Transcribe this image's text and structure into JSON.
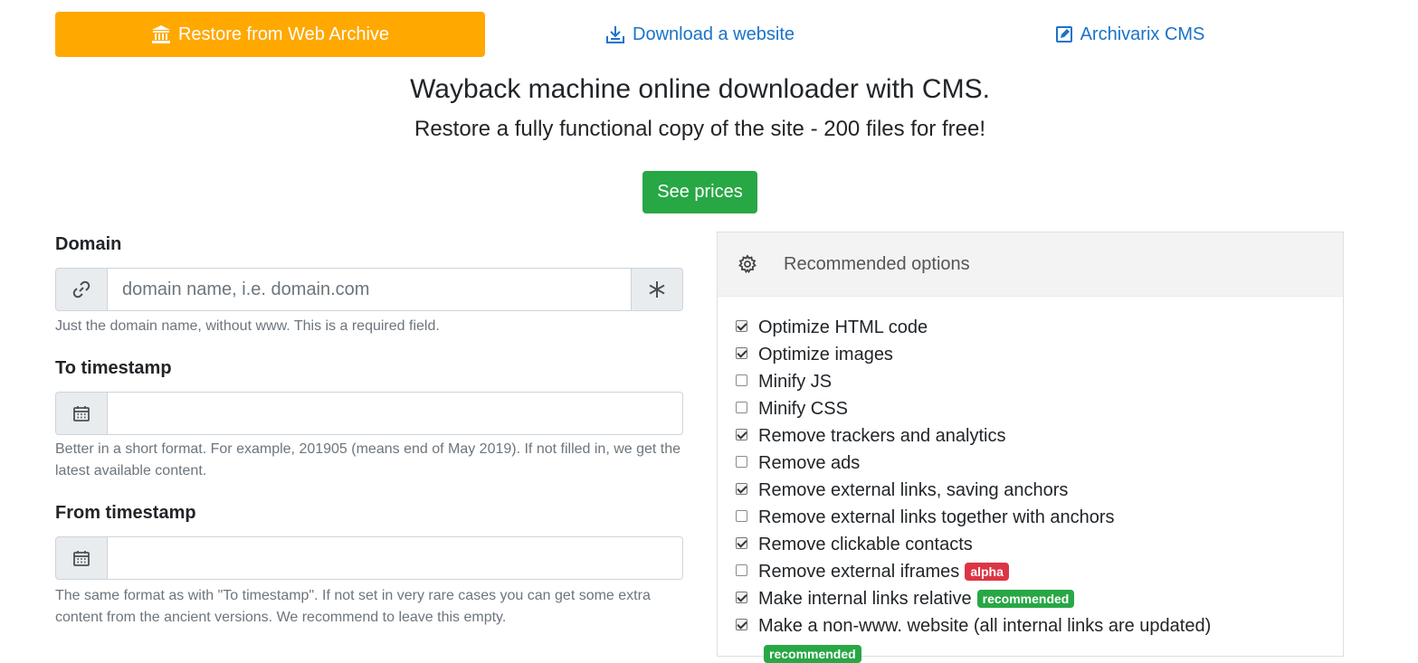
{
  "nav": {
    "restore_label": "Restore from Web Archive",
    "download_label": "Download a website",
    "cms_label": "Archivarix CMS",
    "active_color": "#ffa800",
    "link_color": "#1a73c9"
  },
  "hero": {
    "title": "Wayback machine online downloader with CMS.",
    "subtitle": "Restore a fully functional copy of the site - 200 files for free!",
    "prices_label": "See prices"
  },
  "form": {
    "domain": {
      "label": "Domain",
      "placeholder": "domain name, i.e. domain.com",
      "value": "",
      "help": "Just the domain name, without www. This is a required field."
    },
    "to_timestamp": {
      "label": "To timestamp",
      "value": "",
      "help": "Better in a short format. For example, 201905 (means end of May 2019). If not filled in, we get the latest available content."
    },
    "from_timestamp": {
      "label": "From timestamp",
      "value": "",
      "help": "The same format as with \"To timestamp\". If not set in very rare cases you can get some extra content from the ancient versions. We recommend to leave this empty."
    }
  },
  "options": {
    "title": "Recommended options",
    "items": [
      {
        "label": "Optimize HTML code",
        "checked": true,
        "badge": ""
      },
      {
        "label": "Optimize images",
        "checked": true,
        "badge": ""
      },
      {
        "label": "Minify JS",
        "checked": false,
        "badge": ""
      },
      {
        "label": "Minify CSS",
        "checked": false,
        "badge": ""
      },
      {
        "label": "Remove trackers and analytics",
        "checked": true,
        "badge": ""
      },
      {
        "label": "Remove ads",
        "checked": false,
        "badge": ""
      },
      {
        "label": "Remove external links, saving anchors",
        "checked": true,
        "badge": ""
      },
      {
        "label": "Remove external links together with anchors",
        "checked": false,
        "badge": ""
      },
      {
        "label": "Remove clickable contacts",
        "checked": true,
        "badge": ""
      },
      {
        "label": "Remove external iframes",
        "checked": false,
        "badge": "alpha"
      },
      {
        "label": "Make internal links relative",
        "checked": true,
        "badge": "recommended"
      },
      {
        "label": "Make a non-www. website (all internal links are updated)",
        "checked": true,
        "badge": ""
      }
    ],
    "wrapped_badge": "recommended",
    "badge_alpha_color": "#dc3545",
    "badge_recommended_color": "#28a745"
  }
}
